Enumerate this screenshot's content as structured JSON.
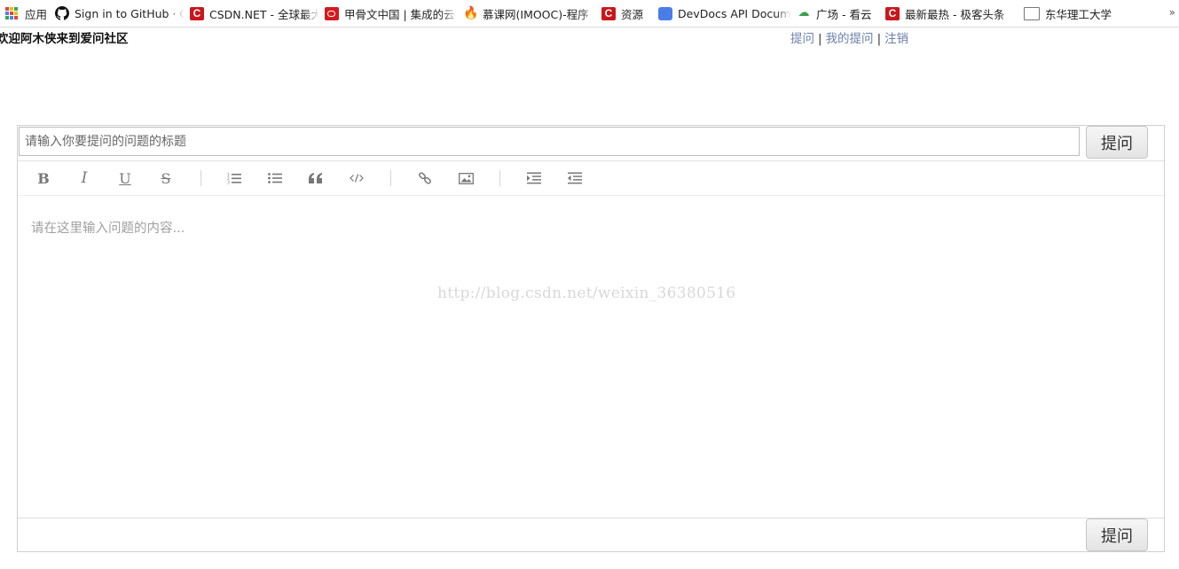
{
  "bookmarks": [
    {
      "label": "应用",
      "icon": "apps-grid-icon"
    },
    {
      "label": "Sign in to GitHub · G",
      "icon": "github-icon"
    },
    {
      "label": "CSDN.NET - 全球最大",
      "icon": "csdn-icon"
    },
    {
      "label": "甲骨文中国 | 集成的云",
      "icon": "oracle-icon"
    },
    {
      "label": "慕课网(IMOOC)-程序",
      "icon": "imooc-flame-icon"
    },
    {
      "label": "资源",
      "icon": "csdn-icon"
    },
    {
      "label": "DevDocs API Docum",
      "icon": "devdocs-icon"
    },
    {
      "label": "广场 - 看云",
      "icon": "kancloud-icon"
    },
    {
      "label": "最新最热 - 极客头条",
      "icon": "csdn-icon"
    },
    {
      "label": "东华理工大学",
      "icon": "page-icon"
    }
  ],
  "bookmarks_overflow": "»",
  "header": {
    "welcome": "欢迎阿木侠来到爱问社区",
    "nav": [
      "提问",
      "我的提问",
      "注销"
    ],
    "separator": "|"
  },
  "form": {
    "title_placeholder": "请输入你要提问的问题的标题",
    "submit_label": "提问",
    "content_placeholder": "请在这里输入问题的内容...",
    "watermark": "http://blog.csdn.net/weixin_36380516"
  },
  "toolbar": {
    "bold": "B",
    "italic": "I",
    "underline": "U",
    "strike": "S"
  },
  "colors": {
    "link": "#6c7fae",
    "csdn_red": "#c9171c"
  }
}
